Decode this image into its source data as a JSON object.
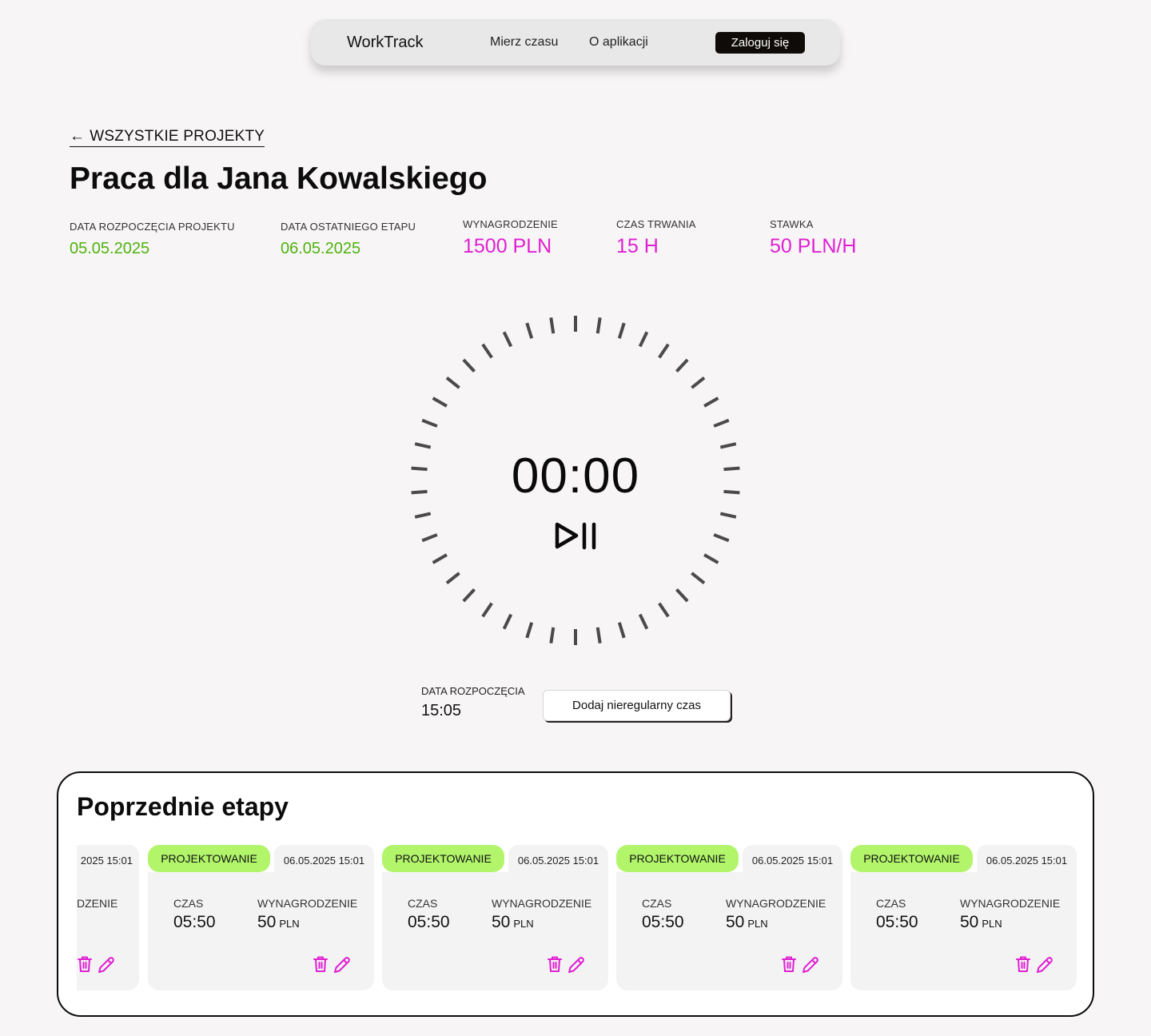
{
  "nav": {
    "brand": "WorkTrack",
    "links": [
      "Mierz czasu",
      "O aplikacji"
    ],
    "login": "Zaloguj się"
  },
  "back": {
    "arrow": "←",
    "label": "WSZYSTKIE PROJEKTY"
  },
  "project": {
    "title": "Praca dla Jana Kowalskiego",
    "stats": [
      {
        "label": "DATA ROZPOCZĘCIA PROJEKTU",
        "value": "05.05.2025"
      },
      {
        "label": "DATA OSTATNIEGO ETAPU",
        "value": "06.05.2025"
      },
      {
        "label": "WYNAGRODZENIE",
        "value": "1500 PLN"
      },
      {
        "label": "CZAS TRWANIA",
        "value": "15 H"
      },
      {
        "label": "STAWKA",
        "value": "50 PLN/H"
      }
    ]
  },
  "timer": {
    "time": "00:00",
    "start_label": "DATA ROZPOCZĘCIA",
    "start_value": "15:05",
    "add_button": "Dodaj nieregularny czas",
    "icon": "play-pause-icon"
  },
  "previous": {
    "title": "Poprzednie etapy",
    "partial_card": {
      "date": "2025 15:01",
      "label": "DZENIE"
    },
    "stages": [
      {
        "name": "PROJEKTOWANIE",
        "date": "06.05.2025 15:01",
        "time_label": "CZAS",
        "time": "05:50",
        "pay_label": "WYNAGRODZENIE",
        "pay": "50",
        "unit": "PLN"
      },
      {
        "name": "PROJEKTOWANIE",
        "date": "06.05.2025 15:01",
        "time_label": "CZAS",
        "time": "05:50",
        "pay_label": "WYNAGRODZENIE",
        "pay": "50",
        "unit": "PLN"
      },
      {
        "name": "PROJEKTOWANIE",
        "date": "06.05.2025 15:01",
        "time_label": "CZAS",
        "time": "05:50",
        "pay_label": "WYNAGRODZENIE",
        "pay": "50",
        "unit": "PLN"
      },
      {
        "name": "PROJEKTOWANIE",
        "date": "06.05.2025 15:01",
        "time_label": "CZAS",
        "time": "05:50",
        "pay_label": "WYNAGRODZENIE",
        "pay": "50",
        "unit": "PLN"
      }
    ],
    "icons": [
      "trash-icon",
      "pencil-icon"
    ]
  },
  "colors": {
    "green": "#4fb20e",
    "magenta": "#e01fd3",
    "pill": "#b2f56b"
  }
}
